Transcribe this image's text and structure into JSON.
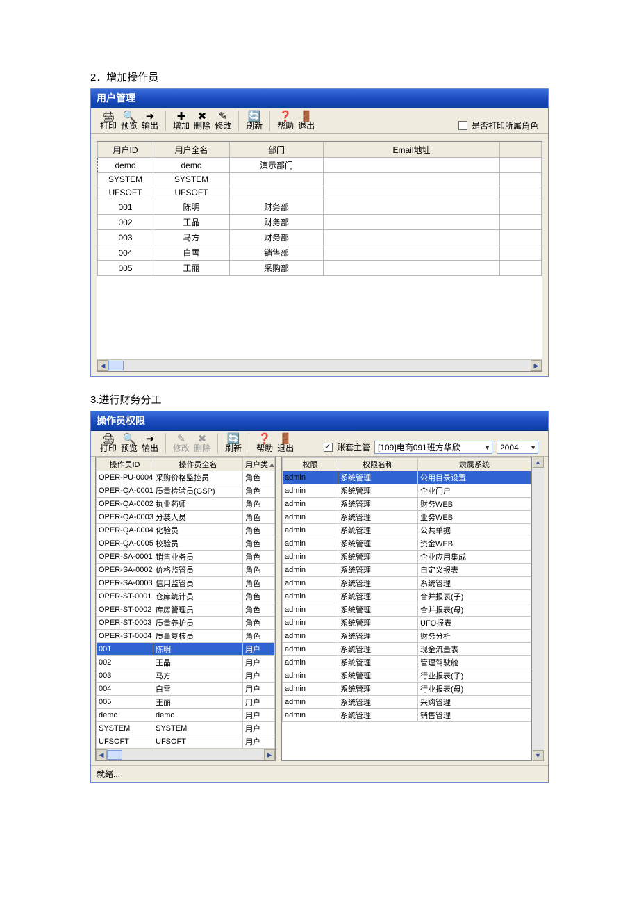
{
  "section1_title": "2．增加操作员",
  "section2_title": "3.进行财务分工",
  "window1": {
    "title": "用户管理",
    "toolbar": {
      "print": "打印",
      "preview": "预览",
      "export": "输出",
      "add": "增加",
      "delete": "删除",
      "edit": "修改",
      "refresh": "刷新",
      "help": "帮助",
      "exit": "退出"
    },
    "print_roles_label": "是否打印所属角色",
    "columns": [
      "用户ID",
      "用户全名",
      "部门",
      "Email地址",
      ""
    ],
    "rows": [
      {
        "id": "demo",
        "name": "demo",
        "dept": "演示部门",
        "email": ""
      },
      {
        "id": "SYSTEM",
        "name": "SYSTEM",
        "dept": "",
        "email": ""
      },
      {
        "id": "UFSOFT",
        "name": "UFSOFT",
        "dept": "",
        "email": ""
      },
      {
        "id": "001",
        "name": "陈明",
        "dept": "财务部",
        "email": ""
      },
      {
        "id": "002",
        "name": "王晶",
        "dept": "财务部",
        "email": ""
      },
      {
        "id": "003",
        "name": "马方",
        "dept": "财务部",
        "email": ""
      },
      {
        "id": "004",
        "name": "白雪",
        "dept": "销售部",
        "email": ""
      },
      {
        "id": "005",
        "name": "王丽",
        "dept": "采购部",
        "email": ""
      }
    ]
  },
  "window2": {
    "title": "操作员权限",
    "toolbar": {
      "print": "打印",
      "preview": "预览",
      "export": "输出",
      "edit": "修改",
      "delete": "删除",
      "refresh": "刷新",
      "help": "帮助",
      "exit": "退出"
    },
    "filter": {
      "supervisor_label": "账套主管",
      "account_set": "[109]电商091班方华欣",
      "year": "2004"
    },
    "left": {
      "columns": [
        "操作员ID",
        "操作员全名",
        "用户类型"
      ],
      "col3_short": "用户类型",
      "rows": [
        {
          "id": "OPER-PU-0004",
          "name": "采购价格监控员",
          "type": "角色"
        },
        {
          "id": "OPER-QA-0001",
          "name": "质量检验员(GSP)",
          "type": "角色"
        },
        {
          "id": "OPER-QA-0002",
          "name": "执业药师",
          "type": "角色"
        },
        {
          "id": "OPER-QA-0003",
          "name": "分装人员",
          "type": "角色"
        },
        {
          "id": "OPER-QA-0004",
          "name": "化验员",
          "type": "角色"
        },
        {
          "id": "OPER-QA-0005",
          "name": "校验员",
          "type": "角色"
        },
        {
          "id": "OPER-SA-0001",
          "name": "销售业务员",
          "type": "角色"
        },
        {
          "id": "OPER-SA-0002",
          "name": "价格监管员",
          "type": "角色"
        },
        {
          "id": "OPER-SA-0003",
          "name": "信用监管员",
          "type": "角色"
        },
        {
          "id": "OPER-ST-0001",
          "name": "仓库统计员",
          "type": "角色"
        },
        {
          "id": "OPER-ST-0002",
          "name": "库房管理员",
          "type": "角色"
        },
        {
          "id": "OPER-ST-0003",
          "name": "质量养护员",
          "type": "角色"
        },
        {
          "id": "OPER-ST-0004",
          "name": "质量复核员",
          "type": "角色"
        },
        {
          "id": "001",
          "name": "陈明",
          "type": "用户",
          "selected": true
        },
        {
          "id": "002",
          "name": "王晶",
          "type": "用户"
        },
        {
          "id": "003",
          "name": "马方",
          "type": "用户"
        },
        {
          "id": "004",
          "name": "白雪",
          "type": "用户"
        },
        {
          "id": "005",
          "name": "王丽",
          "type": "用户"
        },
        {
          "id": "demo",
          "name": "demo",
          "type": "用户"
        },
        {
          "id": "SYSTEM",
          "name": "SYSTEM",
          "type": "用户"
        },
        {
          "id": "UFSOFT",
          "name": "UFSOFT",
          "type": "用户"
        }
      ]
    },
    "right": {
      "columns": [
        "权限",
        "权限名称",
        "隶属系统"
      ],
      "rows": [
        {
          "perm": "admin",
          "pname": "系统管理",
          "sys": "公用目录设置",
          "selected": true
        },
        {
          "perm": "admin",
          "pname": "系统管理",
          "sys": "企业门户"
        },
        {
          "perm": "admin",
          "pname": "系统管理",
          "sys": "财务WEB"
        },
        {
          "perm": "admin",
          "pname": "系统管理",
          "sys": "业务WEB"
        },
        {
          "perm": "admin",
          "pname": "系统管理",
          "sys": "公共单据"
        },
        {
          "perm": "admin",
          "pname": "系统管理",
          "sys": "资金WEB"
        },
        {
          "perm": "admin",
          "pname": "系统管理",
          "sys": "企业应用集成"
        },
        {
          "perm": "admin",
          "pname": "系统管理",
          "sys": "自定义报表"
        },
        {
          "perm": "admin",
          "pname": "系统管理",
          "sys": "系统管理"
        },
        {
          "perm": "admin",
          "pname": "系统管理",
          "sys": "合并报表(子)"
        },
        {
          "perm": "admin",
          "pname": "系统管理",
          "sys": "合并报表(母)"
        },
        {
          "perm": "admin",
          "pname": "系统管理",
          "sys": "UFO报表"
        },
        {
          "perm": "admin",
          "pname": "系统管理",
          "sys": "财务分析"
        },
        {
          "perm": "admin",
          "pname": "系统管理",
          "sys": "现金流量表"
        },
        {
          "perm": "admin",
          "pname": "系统管理",
          "sys": "管理驾驶舱"
        },
        {
          "perm": "admin",
          "pname": "系统管理",
          "sys": "行业报表(子)"
        },
        {
          "perm": "admin",
          "pname": "系统管理",
          "sys": "行业报表(母)"
        },
        {
          "perm": "admin",
          "pname": "系统管理",
          "sys": "采购管理"
        },
        {
          "perm": "admin",
          "pname": "系统管理",
          "sys": "销售管理"
        }
      ]
    },
    "status": "就绪..."
  }
}
